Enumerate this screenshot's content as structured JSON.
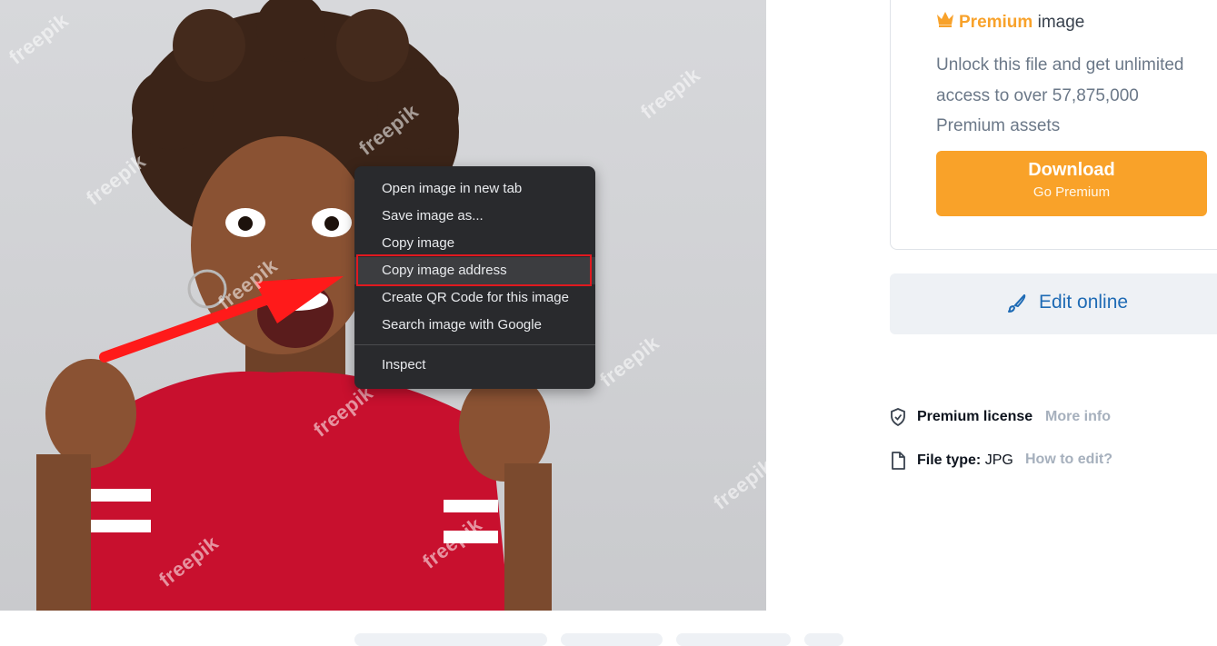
{
  "context_menu": {
    "items": [
      "Open image in new tab",
      "Save image as...",
      "Copy image",
      "Copy image address",
      "Create QR Code for this image",
      "Search image with Google",
      "Inspect"
    ],
    "highlighted_item": "Copy image address"
  },
  "watermark_text": "freepik",
  "premium": {
    "icon": "crown-icon",
    "title_highlight": "Premium",
    "title_rest": "image",
    "description": "Unlock this file and get unlimited access to over 57,875,000 Premium assets",
    "download_label": "Download",
    "download_sub": "Go Premium"
  },
  "edit": {
    "icon": "brush-icon",
    "label": "Edit online"
  },
  "license": {
    "icon": "shield-icon",
    "label": "Premium license",
    "link": "More info"
  },
  "filetype": {
    "icon": "file-icon",
    "label": "File type:",
    "value": "JPG",
    "link": "How to edit?"
  },
  "colors": {
    "accent": "#f9a229",
    "menu_bg": "#292a2d",
    "highlight_border": "#e0191f",
    "edit_text": "#1f6bb5",
    "arrow": "#ff1a1a",
    "shirt": "#c8102e"
  }
}
